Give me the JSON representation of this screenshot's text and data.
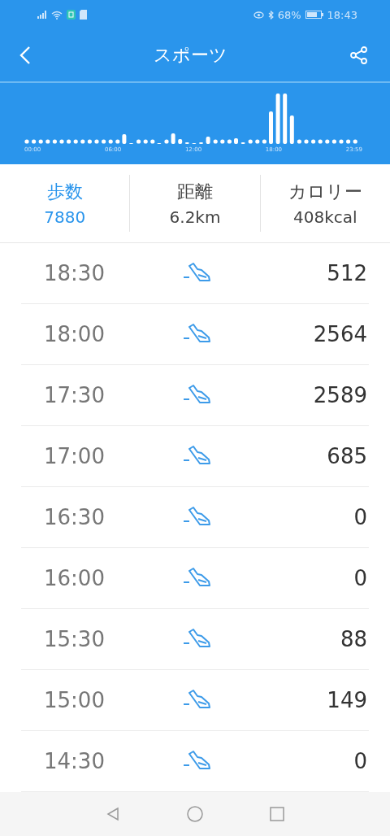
{
  "status_bar": {
    "battery": "68%",
    "time": "18:43"
  },
  "header": {
    "title": "スポーツ"
  },
  "chart_labels": [
    "00:00",
    "06:00",
    "12:00",
    "18:00",
    "23:59"
  ],
  "stats": [
    {
      "label": "歩数",
      "value": "7880",
      "selected": true
    },
    {
      "label": "距離",
      "value": "6.2km",
      "selected": false
    },
    {
      "label": "カロリー",
      "value": "408kcal",
      "selected": false
    }
  ],
  "rows": [
    {
      "time": "18:30",
      "steps": "512"
    },
    {
      "time": "18:00",
      "steps": "2564"
    },
    {
      "time": "17:30",
      "steps": "2589"
    },
    {
      "time": "17:00",
      "steps": "685"
    },
    {
      "time": "16:30",
      "steps": "0"
    },
    {
      "time": "16:00",
      "steps": "0"
    },
    {
      "time": "15:30",
      "steps": "88"
    },
    {
      "time": "15:00",
      "steps": "149"
    },
    {
      "time": "14:30",
      "steps": "0"
    }
  ]
}
